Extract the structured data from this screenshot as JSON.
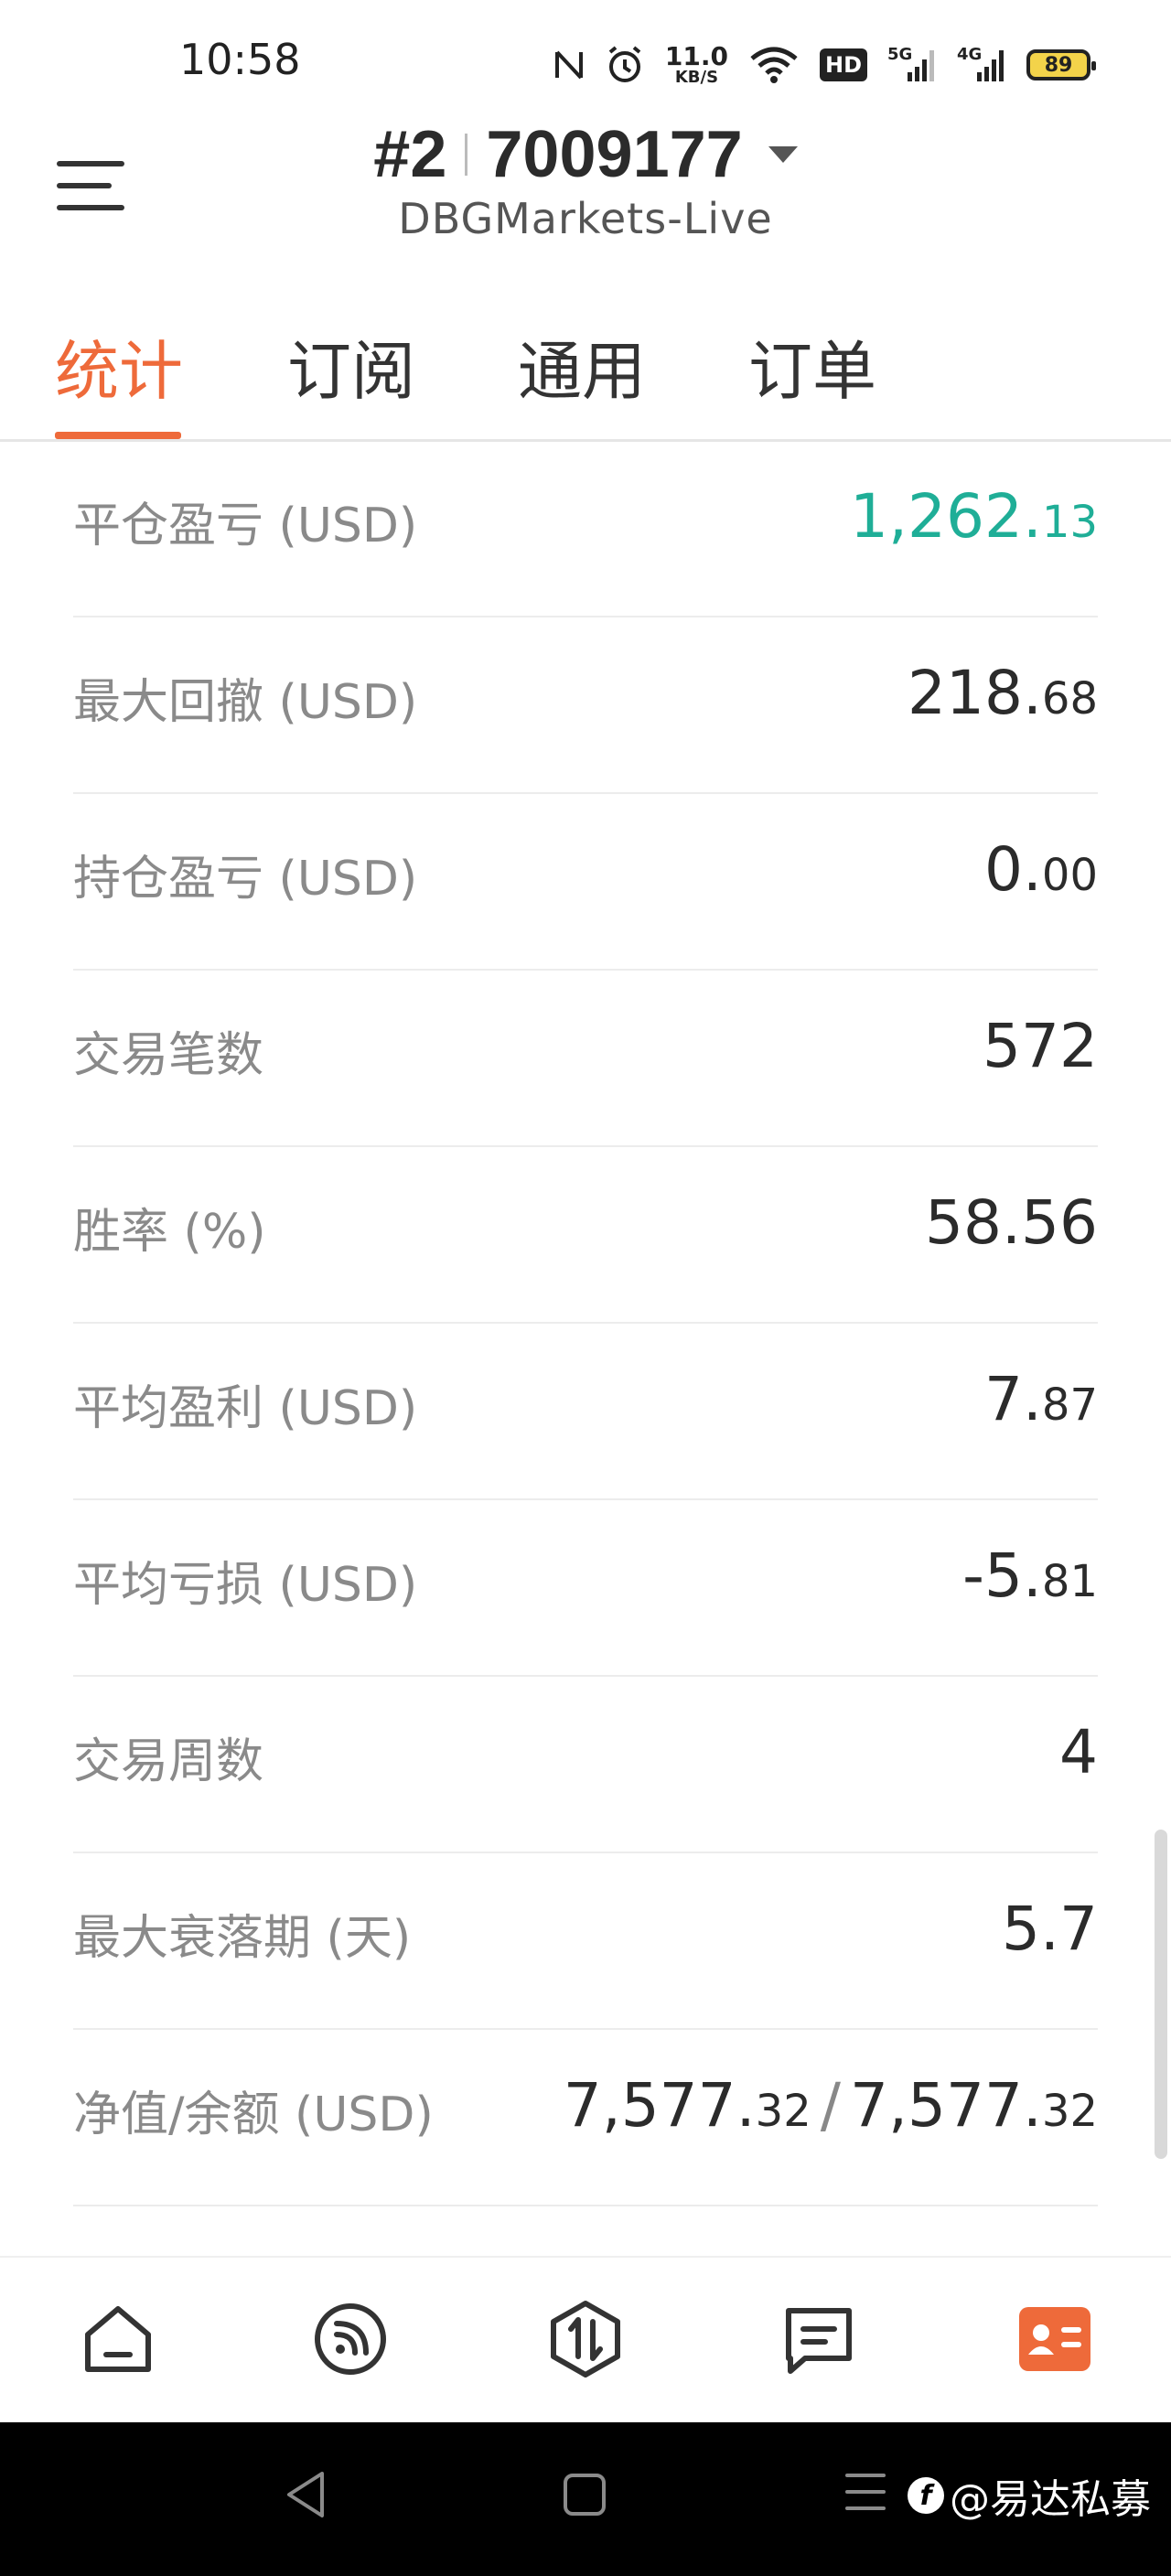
{
  "status_bar": {
    "time": "10:58",
    "net_speed_value": "11.0",
    "net_speed_unit": "KB/S",
    "hd_label": "HD",
    "signal_5g_label": "5G",
    "signal_4g_label": "4G",
    "battery": "89"
  },
  "header": {
    "account_index": "#2",
    "account_number": "7009177",
    "server": "DBGMarkets-Live"
  },
  "tabs": [
    {
      "label": "统计",
      "active": true
    },
    {
      "label": "订阅",
      "active": false
    },
    {
      "label": "通用",
      "active": false
    },
    {
      "label": "订单",
      "active": false
    }
  ],
  "stats": [
    {
      "label": "平仓盈亏 (USD)",
      "int": "1,262.",
      "dec": "13",
      "color": "#1fae97"
    },
    {
      "label": "最大回撤 (USD)",
      "int": "218.",
      "dec": "68"
    },
    {
      "label": "持仓盈亏 (USD)",
      "int": "0.",
      "dec": "00"
    },
    {
      "label": "交易笔数",
      "int": "572",
      "dec": ""
    },
    {
      "label": "胜率 (%)",
      "int": "58.56",
      "dec": ""
    },
    {
      "label": "平均盈利 (USD)",
      "int": "7.",
      "dec": "87"
    },
    {
      "label": "平均亏损 (USD)",
      "int": "-5.",
      "dec": "81"
    },
    {
      "label": "交易周数",
      "int": "4",
      "dec": ""
    },
    {
      "label": "最大衰落期 (天)",
      "int": "5.7",
      "dec": ""
    },
    {
      "label": "净值/余额 (USD)",
      "equity_int": "7,577.",
      "equity_dec": "32",
      "separator": "/",
      "balance_int": "7,577.",
      "balance_dec": "32"
    }
  ],
  "bottom_nav": [
    {
      "icon": "home-icon",
      "active": false
    },
    {
      "icon": "signal-feed-icon",
      "active": false
    },
    {
      "icon": "trade-icon",
      "active": false
    },
    {
      "icon": "messages-icon",
      "active": false
    },
    {
      "icon": "profile-card-icon",
      "active": true
    }
  ],
  "accent_color": "#ee6a3a",
  "watermark": "@易达私募"
}
